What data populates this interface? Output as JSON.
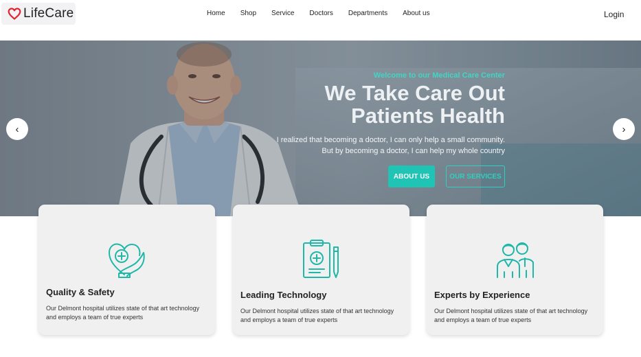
{
  "brand": {
    "name": "LifeCare",
    "accent": "#1fc4b4",
    "heart_color": "#e0242f"
  },
  "nav": {
    "items": [
      "Home",
      "Shop",
      "Service",
      "Doctors",
      "Departments",
      "About us"
    ],
    "login": "Login"
  },
  "hero": {
    "welcome": "Welcome to our Medical Care Center",
    "headline_line1": "We Take Care Out",
    "headline_line2": "Patients Health",
    "sub_line1": "I realized that becoming a doctor, I can only help a small community.",
    "sub_line2": "But by becoming a doctor, I can help my whole country",
    "about_button": "ABOUT US",
    "services_button": "OUR SERVICES",
    "prev_icon": "chevron-left-icon",
    "next_icon": "chevron-right-icon"
  },
  "cards": [
    {
      "icon": "heart-hand-icon",
      "title": "Quality & Safety",
      "text": "Our Delmont hospital utilizes state of that art technology and employs a team of true experts"
    },
    {
      "icon": "clipboard-medical-icon",
      "title": "Leading Technology",
      "text": "Our Delmont hospital utilizes state of that art technology and employs a team of true experts"
    },
    {
      "icon": "doctors-team-icon",
      "title": "Experts by Experience",
      "text": "Our Delmont hospital utilizes state of that art technology and employs a team of true experts"
    }
  ]
}
